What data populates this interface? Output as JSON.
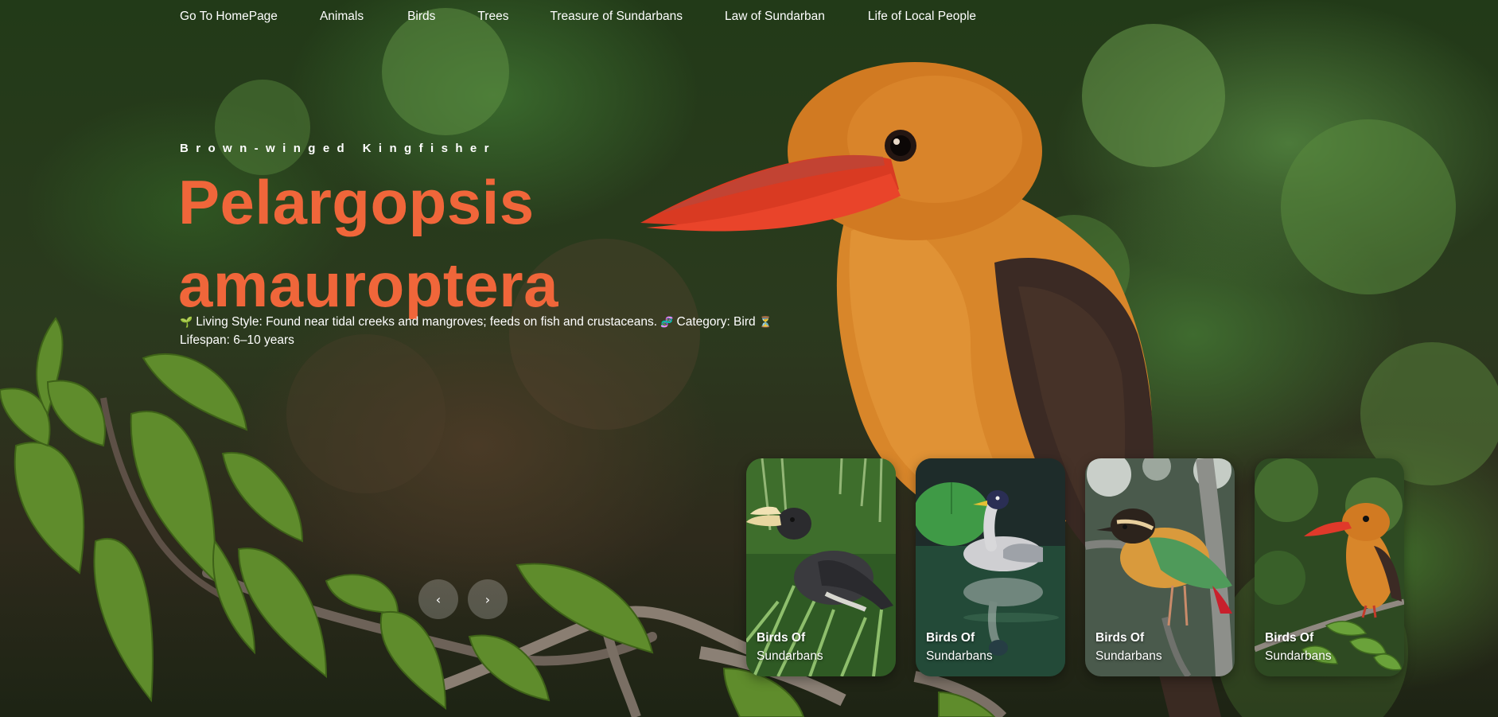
{
  "nav": {
    "items": [
      {
        "label": "Go To HomePage"
      },
      {
        "label": "Animals"
      },
      {
        "label": "Birds"
      },
      {
        "label": "Trees"
      },
      {
        "label": "Treasure of Sundarbans"
      },
      {
        "label": "Law of Sundarban"
      },
      {
        "label": "Life of Local People"
      }
    ]
  },
  "hero": {
    "common_name": "Brown-winged Kingfisher",
    "title_line1": "Pelargopsis",
    "title_line2": "amauroptera",
    "living_style_icon": "🌱",
    "living_style": "Living Style: Found near tidal creeks and mangroves; feeds on fish and crustaceans.",
    "category_icon": "🧬",
    "category": "Category: Bird",
    "lifespan_icon": "⏳",
    "lifespan": "Lifespan: 6–10 years"
  },
  "slider": {
    "prev_label": "‹",
    "next_label": "›"
  },
  "cards": [
    {
      "title": "Birds Of",
      "subtitle": "Sundarbans",
      "subject": "hornbill"
    },
    {
      "title": "Birds Of",
      "subtitle": "Sundarbans",
      "subject": "duck"
    },
    {
      "title": "Birds Of",
      "subtitle": "Sundarbans",
      "subject": "pitta"
    },
    {
      "title": "Birds Of",
      "subtitle": "Sundarbans",
      "subject": "kingfisher"
    }
  ],
  "colors": {
    "accent_title": "#f0663a",
    "text": "#ffffff"
  }
}
